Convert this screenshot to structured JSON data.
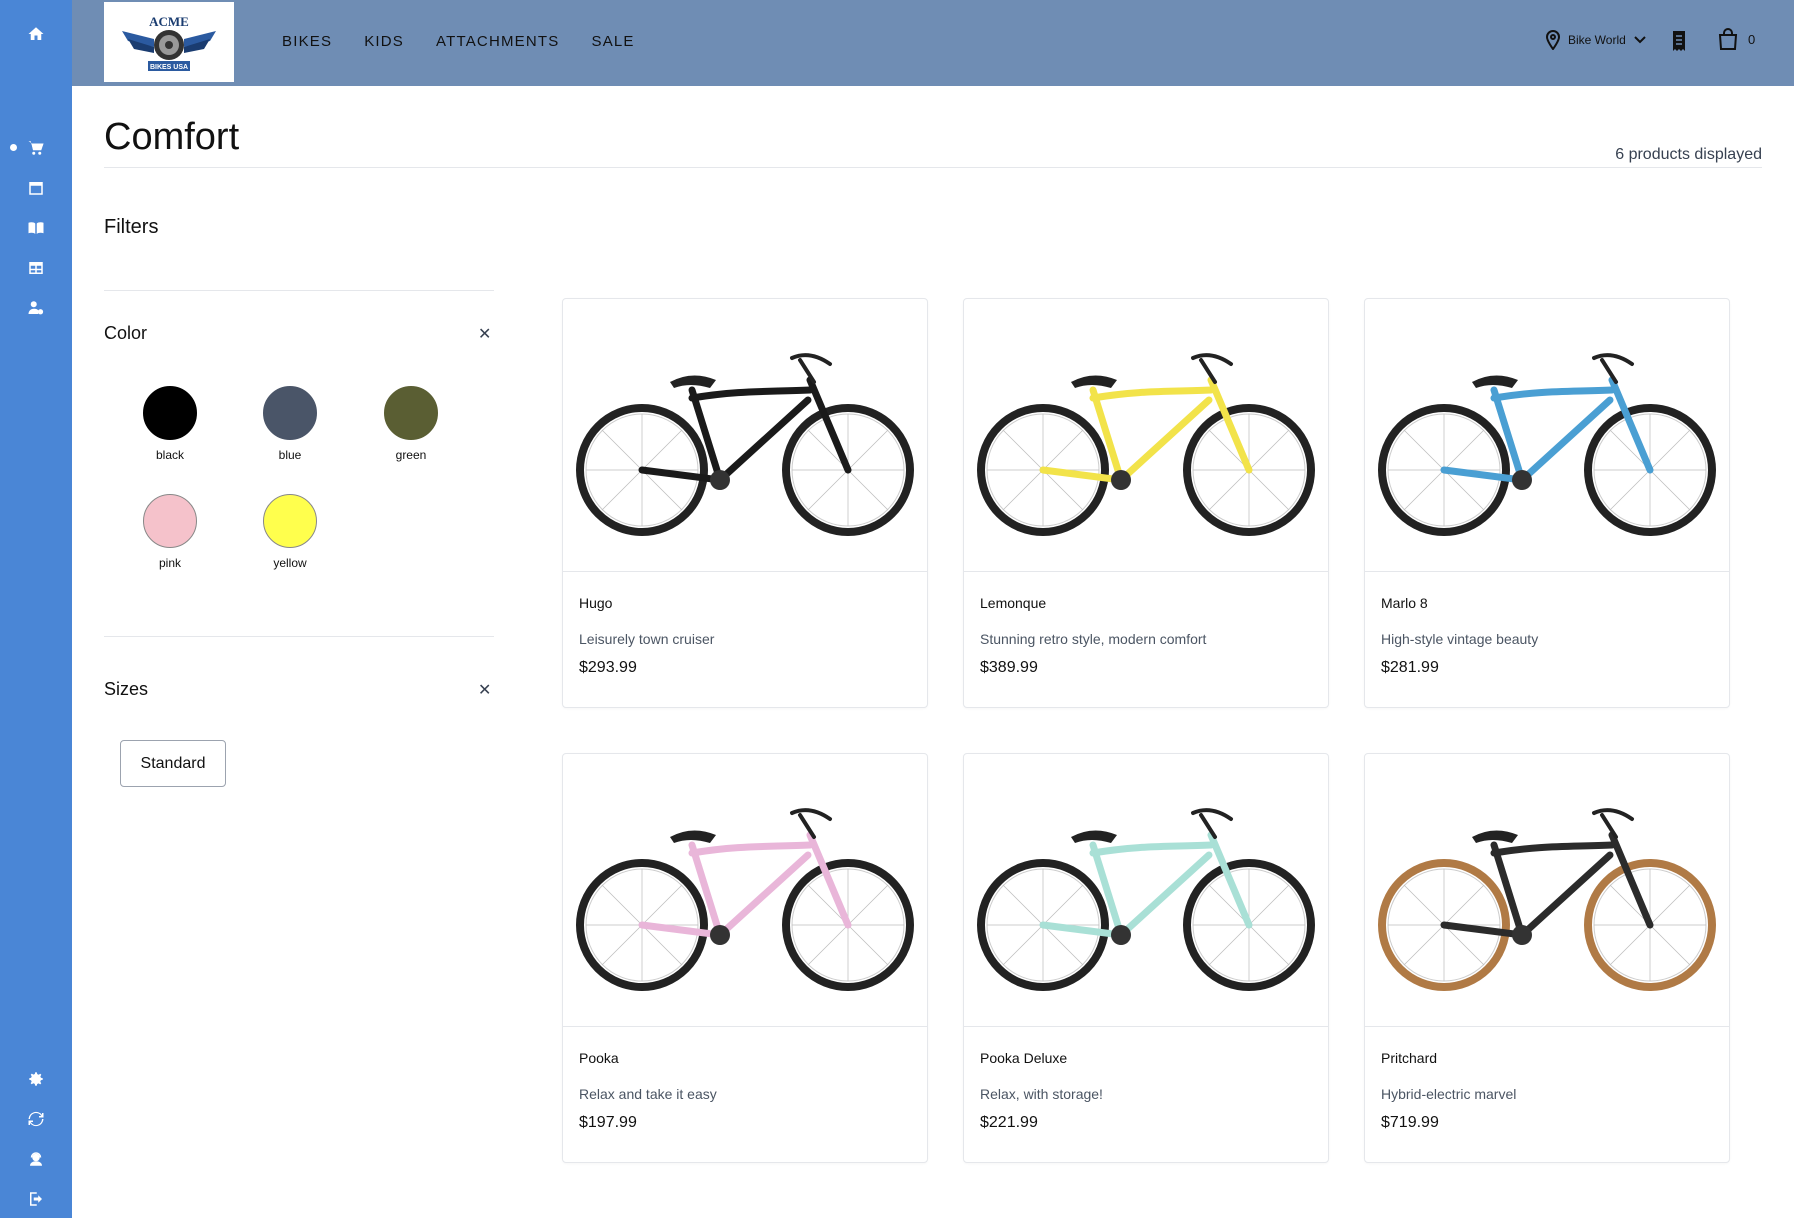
{
  "header": {
    "logo_text": "ACME",
    "logo_subtext": "BIKES USA",
    "nav": [
      "BIKES",
      "KIDS",
      "ATTACHMENTS",
      "SALE"
    ],
    "store_name": "Bike World",
    "cart_count": "0"
  },
  "sidebar": {
    "top_icon": "home-icon",
    "items": [
      "cart-icon",
      "calendar-icon",
      "book-icon",
      "table-icon",
      "user-settings-icon"
    ],
    "bottom_items": [
      "gear-icon",
      "sync-icon",
      "support-icon",
      "logout-icon"
    ]
  },
  "page": {
    "title": "Comfort",
    "count_text": "6 products displayed"
  },
  "filters": {
    "title": "Filters",
    "color": {
      "title": "Color",
      "clear": "✕",
      "options": [
        {
          "label": "black",
          "hex": "#000000"
        },
        {
          "label": "blue",
          "hex": "#4a5568"
        },
        {
          "label": "green",
          "hex": "#5a5e33"
        },
        {
          "label": "pink",
          "hex": "#f5c2cb"
        },
        {
          "label": "yellow",
          "hex": "#ffff4d"
        }
      ]
    },
    "sizes": {
      "title": "Sizes",
      "clear": "✕",
      "options": [
        "Standard"
      ]
    }
  },
  "products": [
    {
      "name": "Hugo",
      "desc": "Leisurely town cruiser",
      "price": "$293.99",
      "frame": "#1a1a1a",
      "tires": "#222222"
    },
    {
      "name": "Lemonque",
      "desc": "Stunning retro style, modern comfort",
      "price": "$389.99",
      "frame": "#f2e34a",
      "tires": "#222222"
    },
    {
      "name": "Marlo 8",
      "desc": "High-style vintage beauty",
      "price": "$281.99",
      "frame": "#4a9fd3",
      "tires": "#222222"
    },
    {
      "name": "Pooka",
      "desc": "Relax and take it easy",
      "price": "$197.99",
      "frame": "#e9b6d9",
      "tires": "#222222"
    },
    {
      "name": "Pooka Deluxe",
      "desc": "Relax, with storage!",
      "price": "$221.99",
      "frame": "#a9e0d6",
      "tires": "#222222"
    },
    {
      "name": "Pritchard",
      "desc": "Hybrid-electric marvel",
      "price": "$719.99",
      "frame": "#2b2b2b",
      "tires": "#b07a45"
    }
  ]
}
